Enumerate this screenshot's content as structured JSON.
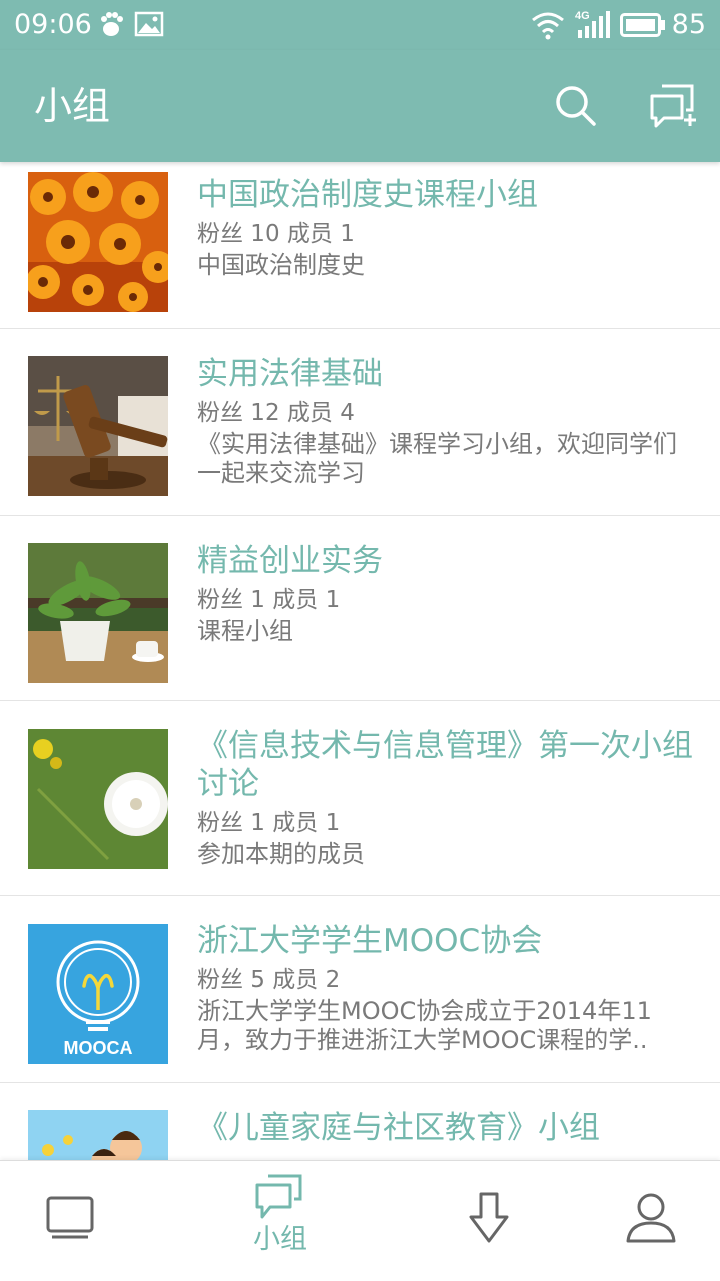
{
  "status_bar": {
    "time": "09:06",
    "icons": [
      "baidu-paw-icon",
      "image-icon",
      "wifi-icon",
      "4g-signal-icon",
      "battery-icon"
    ],
    "network_label": "4G",
    "battery": "85"
  },
  "header": {
    "title": "小组",
    "actions": [
      "search-icon",
      "new-group-chat-icon"
    ]
  },
  "groups": [
    {
      "title": "中国政治制度史课程小组",
      "stats": "粉丝 10  成员 1",
      "description": "中国政治制度史",
      "image": "orange-daisies"
    },
    {
      "title": "实用法律基础",
      "stats": "粉丝 12  成员 4",
      "description": "《实用法律基础》课程学习小组，欢迎同学们一起来交流学习",
      "image": "gavel-and-scales"
    },
    {
      "title": "精益创业实务",
      "stats": "粉丝 1  成员 1",
      "description": "课程小组",
      "image": "potted-plant-and-teacup"
    },
    {
      "title": "《信息技术与信息管理》第一次小组讨论",
      "stats": "粉丝 1  成员 1",
      "description": "参加本期的成员",
      "image": "dandelion"
    },
    {
      "title": "浙江大学学生MOOC协会",
      "stats": "粉丝 5  成员 2",
      "description": "浙江大学学生MOOC协会成立于2014年11月，致力于推进浙江大学MOOC课程的学..",
      "image": "mooca-lightbulb-logo",
      "logo_text": "MOOCA"
    },
    {
      "title": "《儿童家庭与社区教育》小组",
      "stats": "",
      "description": "",
      "image": "children-cartoon"
    }
  ],
  "tab_bar": {
    "tabs": [
      {
        "icon": "monitor-icon",
        "label": "",
        "active": false
      },
      {
        "icon": "group-chat-icon",
        "label": "小组",
        "active": true
      },
      {
        "icon": "download-arrow-icon",
        "label": "",
        "active": false
      },
      {
        "icon": "person-icon",
        "label": "",
        "active": false
      }
    ]
  },
  "colors": {
    "primary": "#7ebbb1",
    "accent_text": "#74b8ad",
    "secondary_text": "#7a7a7a",
    "divider": "#e4e4e4",
    "inactive_icon": "#666666"
  }
}
